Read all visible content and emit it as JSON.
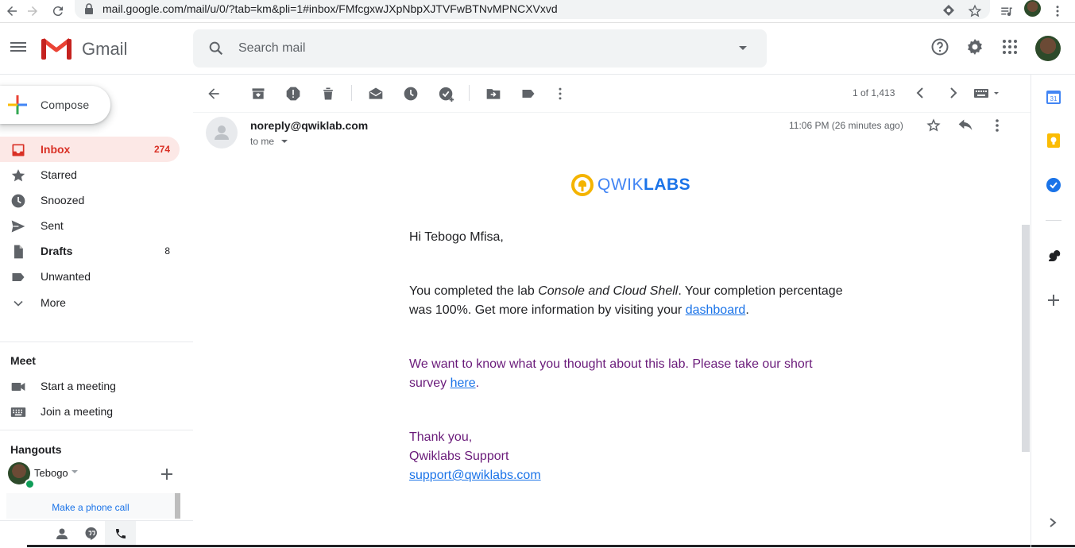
{
  "browser": {
    "url": "mail.google.com/mail/u/0/?tab=km&pli=1#inbox/FMfcgxwJXpNbpXJTVFwBTNvMPNCXVxvd"
  },
  "app": {
    "name": "Gmail"
  },
  "search": {
    "placeholder": "Search mail"
  },
  "compose": {
    "label": "Compose"
  },
  "sidebar": {
    "items": [
      {
        "label": "Inbox",
        "count": "274"
      },
      {
        "label": "Starred",
        "count": ""
      },
      {
        "label": "Snoozed",
        "count": ""
      },
      {
        "label": "Sent",
        "count": ""
      },
      {
        "label": "Drafts",
        "count": "8"
      },
      {
        "label": "Unwanted",
        "count": ""
      },
      {
        "label": "More",
        "count": ""
      }
    ]
  },
  "meet": {
    "title": "Meet",
    "items": [
      {
        "label": "Start a meeting"
      },
      {
        "label": "Join a meeting"
      }
    ]
  },
  "hangouts": {
    "title": "Hangouts",
    "user": "Tebogo",
    "phone_link": "Make a phone call"
  },
  "toolbar": {
    "pager": "1 of 1,413"
  },
  "message": {
    "sender": "noreply@qwiklab.com",
    "to": "to me",
    "time": "11:06 PM (26 minutes ago)",
    "logo_q": "QWIK",
    "logo_labs": "LABS",
    "greeting": "Hi Tebogo Mfisa,",
    "p1_a": "You completed the lab ",
    "p1_lab": "Console and Cloud Shell",
    "p1_b": ". Your completion percentage was 100%. Get more information by visiting your ",
    "p1_link": "dashboard",
    "p1_end": ".",
    "p2_a": "We want to know what you thought about this lab. Please take our short survey ",
    "p2_link": "here",
    "p2_end": ".",
    "signoff": "Thank you,",
    "team": "Qwiklabs Support",
    "email": "support@qwiklabs.com"
  },
  "colors": {
    "accent_red": "#d93025",
    "link_blue": "#1a73e8",
    "survey_purple": "#6a1b7a",
    "qwik_yellow": "#f4b400"
  }
}
